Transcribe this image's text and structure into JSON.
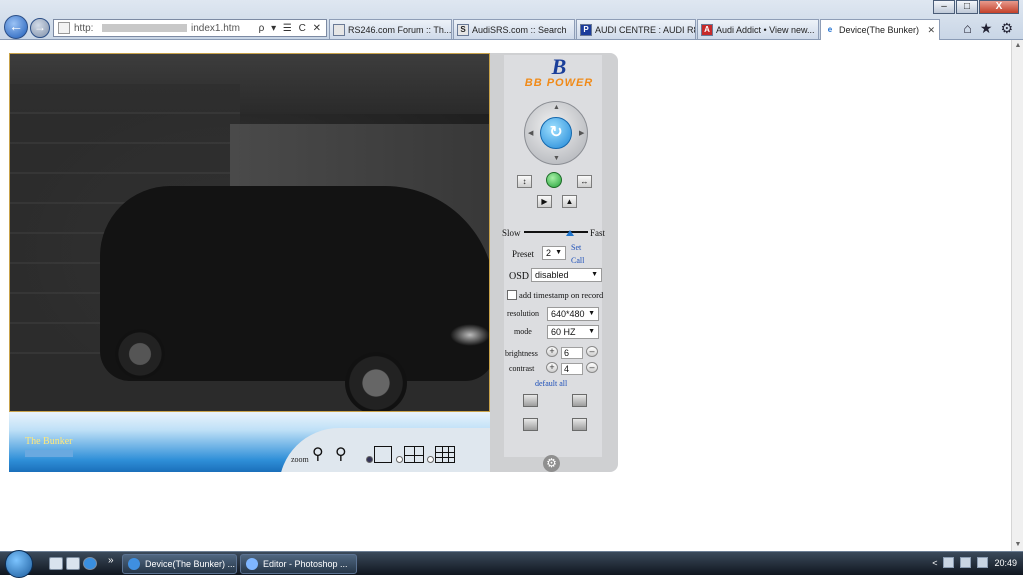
{
  "browser": {
    "window_buttons": [
      "–",
      "□",
      "X"
    ],
    "address": {
      "prefix": "http:",
      "suffix": "index1.htm",
      "tools": "ρ ▾ ☰ C ✕"
    },
    "tabs": [
      {
        "icon": "",
        "label": "RS246.com Forum :: Th..."
      },
      {
        "icon": "S",
        "label": "AudiSRS.com :: Search"
      },
      {
        "icon": "P",
        "label": "AUDI CENTRE : AUDI R8 ..."
      },
      {
        "icon": "A",
        "label": "Audi Addict • View new..."
      },
      {
        "icon": "e",
        "label": "Device(The Bunker)",
        "close": "✕"
      }
    ],
    "toolbar_icons": [
      "⌂",
      "★",
      "⚙"
    ]
  },
  "camera": {
    "name": "The Bunker",
    "zoom_label": "zoom",
    "view_modes": [
      "single-view",
      "quad-view",
      "nine-view"
    ]
  },
  "controls": {
    "logo_mark": "B",
    "logo_text": "BB POWER",
    "speed": {
      "slow_label": "Slow",
      "fast_label": "Fast"
    },
    "preset": {
      "label": "Preset",
      "value": "2",
      "set_label": "Set",
      "call_label": "Call"
    },
    "osd": {
      "label": "OSD",
      "value": "disabled"
    },
    "timestamp_label": "add timestamp on record",
    "resolution": {
      "label": "resolution",
      "value": "640*480"
    },
    "mode": {
      "label": "mode",
      "value": "60 HZ"
    },
    "brightness": {
      "label": "brightness",
      "value": "6"
    },
    "contrast": {
      "label": "contrast",
      "value": "4"
    },
    "default_all_label": "default all"
  },
  "taskbar": {
    "tasks": [
      {
        "label": "Device(The Bunker) ..."
      },
      {
        "label": "Editor - Photoshop ..."
      }
    ],
    "overflow": "»",
    "clock": "20:49"
  }
}
